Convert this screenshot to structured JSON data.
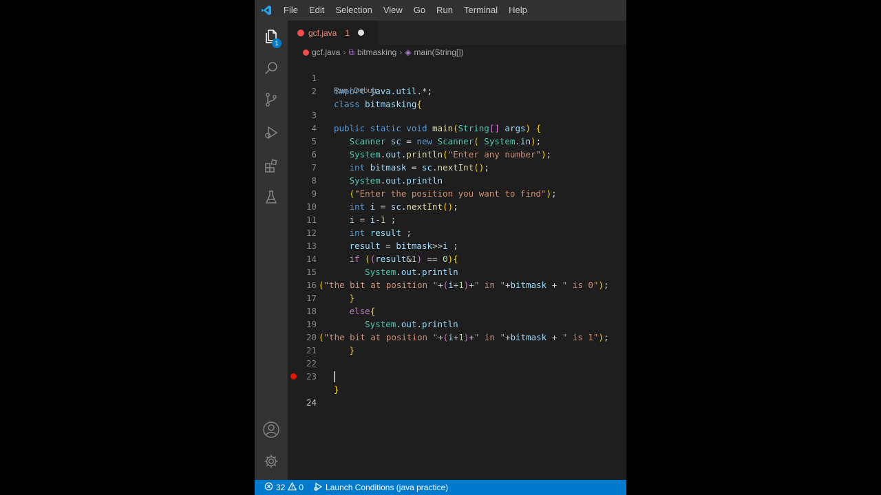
{
  "menu": [
    "File",
    "Edit",
    "Selection",
    "View",
    "Go",
    "Run",
    "Terminal",
    "Help"
  ],
  "activity_bar": {
    "explorer_badge": "1",
    "icons": [
      "files-icon",
      "search-icon",
      "source-control-icon",
      "run-debug-icon",
      "extensions-icon",
      "testing-icon",
      "account-icon",
      "gear-icon"
    ]
  },
  "tab": {
    "filename": "gcf.java",
    "problem_count": "1"
  },
  "breadcrumb": {
    "file": "gcf.java",
    "class": "bitmasking",
    "method": "main(String[])"
  },
  "codelens": "Run | Debug",
  "code_lines": [
    {
      "n": "1",
      "text": "import java.util.*;"
    },
    {
      "n": "2",
      "text": "class bitmasking{"
    },
    {
      "n": "3",
      "text": "public static void main(String[] args) {"
    },
    {
      "n": "4",
      "text": "   Scanner sc = new Scanner( System.in);"
    },
    {
      "n": "5",
      "text": "   System.out.println(\"Enter any number\");"
    },
    {
      "n": "6",
      "text": "   int bitmask = sc.nextInt();"
    },
    {
      "n": "7",
      "text": "   System.out.println"
    },
    {
      "n": "8",
      "text": "   (\"Enter the position you want to find\");"
    },
    {
      "n": "9",
      "text": "   int i = sc.nextInt();"
    },
    {
      "n": "10",
      "text": "   i = i-1 ;"
    },
    {
      "n": "11",
      "text": "   int result ;"
    },
    {
      "n": "12",
      "text": "   result = bitmask>>i ;"
    },
    {
      "n": "13",
      "text": "   if ((result&1) == 0){"
    },
    {
      "n": "14",
      "text": "      System.out.println"
    },
    {
      "n": "15",
      "text": "(\"the bit at position \"+(i+1)+\" in \"+bitmask + \" is 0\");"
    },
    {
      "n": "16",
      "text": "   }"
    },
    {
      "n": "17",
      "text": "   else{"
    },
    {
      "n": "18",
      "text": "      System.out.println"
    },
    {
      "n": "19",
      "text": "(\"the bit at position \"+(i+1)+\" in \"+bitmask + \" is 1\");"
    },
    {
      "n": "20",
      "text": "   }"
    },
    {
      "n": "21",
      "text": ""
    },
    {
      "n": "22",
      "text": ""
    },
    {
      "n": "23",
      "text": "}"
    },
    {
      "n": "24",
      "text": ""
    }
  ],
  "breakpoint_line": "24",
  "status_bar": {
    "errors": "32",
    "warnings": "0",
    "launch": "Launch Conditions (java practice)"
  },
  "colors": {
    "accent": "#007acc",
    "editor_bg": "#1e1e1e",
    "activity_bar": "#333333",
    "error": "#f14c4c"
  }
}
